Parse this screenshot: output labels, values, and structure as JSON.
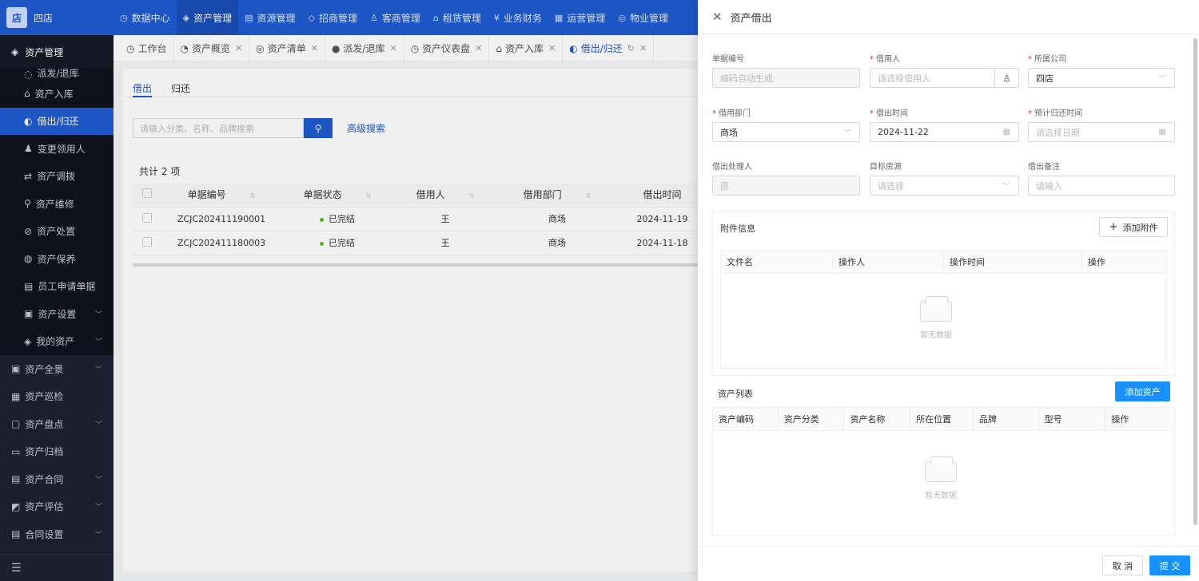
{
  "app": {
    "logo_text": "四店",
    "logo_glyph": "店"
  },
  "topnav": [
    {
      "icon": "◷",
      "label": "数据中心"
    },
    {
      "icon": "◈",
      "label": "资产管理",
      "active": true
    },
    {
      "icon": "▤",
      "label": "资源管理"
    },
    {
      "icon": "◇",
      "label": "招商管理"
    },
    {
      "icon": "♙",
      "label": "客商管理"
    },
    {
      "icon": "⌂",
      "label": "租赁管理"
    },
    {
      "icon": "¥",
      "label": "业务财务"
    },
    {
      "icon": "▦",
      "label": "运营管理"
    },
    {
      "icon": "◎",
      "label": "物业管理"
    }
  ],
  "sidebar": {
    "group": "资产管理",
    "items": [
      {
        "label": "派发/退库",
        "icon": "◌"
      },
      {
        "label": "资产入库",
        "icon": "⌂"
      },
      {
        "label": "借出/归还",
        "icon": "◐",
        "active": true
      },
      {
        "label": "变更领用人",
        "icon": "♟"
      },
      {
        "label": "资产调拨",
        "icon": "⇄"
      },
      {
        "label": "资产维修",
        "icon": "⚲"
      },
      {
        "label": "资产处置",
        "icon": "⊘"
      },
      {
        "label": "资产保养",
        "icon": "◍"
      },
      {
        "label": "员工申请单据",
        "icon": "▤"
      },
      {
        "label": "资产设置",
        "icon": "▣",
        "chev": true
      },
      {
        "label": "我的资产",
        "icon": "◈",
        "chev": true
      }
    ],
    "top_items": [
      {
        "label": "资产全景",
        "icon": "▣",
        "chev": true
      },
      {
        "label": "资产巡检",
        "icon": "▦"
      },
      {
        "label": "资产盘点",
        "icon": "▢",
        "chev": true
      },
      {
        "label": "资产归档",
        "icon": "▭"
      },
      {
        "label": "资产合同",
        "icon": "▤",
        "chev": true
      },
      {
        "label": "资产评估",
        "icon": "◩",
        "chev": true
      },
      {
        "label": "合同设置",
        "icon": "▤",
        "chev": true
      }
    ],
    "collapse_icon": "☰"
  },
  "tabs": [
    {
      "icon": "◷",
      "label": "工作台",
      "closable": false
    },
    {
      "icon": "◔",
      "label": "资产概览",
      "closable": true
    },
    {
      "icon": "◎",
      "label": "资产清单",
      "closable": true
    },
    {
      "icon": "●",
      "label": "派发/退库",
      "closable": true
    },
    {
      "icon": "◷",
      "label": "资产仪表盘",
      "closable": true
    },
    {
      "icon": "⌂",
      "label": "资产入库",
      "closable": true
    },
    {
      "icon": "◐",
      "label": "借出/归还",
      "closable": true,
      "active": true,
      "refresh": "↻"
    }
  ],
  "main": {
    "subtabs": [
      "借出",
      "归还"
    ],
    "search_placeholder": "请输入分类、名称、品牌搜索",
    "search_icon": "⚲",
    "advanced": "高级搜索",
    "total": "共计 2 项",
    "columns": [
      "单据编号",
      "单据状态",
      "借用人",
      "借用部门",
      "借出时间"
    ],
    "rows": [
      {
        "no": "ZCJC202411190001",
        "status": "已完结",
        "borrower": "王",
        "dept": "商场",
        "time": "2024-11-19"
      },
      {
        "no": "ZCJC202411180003",
        "status": "已完结",
        "borrower": "王",
        "dept": "商场",
        "time": "2024-11-18"
      }
    ]
  },
  "drawer": {
    "title": "资产借出",
    "close_icon": "✕",
    "fields": {
      "doc_no": {
        "label": "单据编号",
        "placeholder": "编码自动生成"
      },
      "borrower": {
        "label": "借用人",
        "placeholder": "请选择借用人",
        "icon": "♙"
      },
      "company": {
        "label": "所属公司",
        "value": "四店"
      },
      "dept": {
        "label": "借用部门",
        "value": "商场"
      },
      "lend_time": {
        "label": "借出时间",
        "value": "2024-11-22"
      },
      "return_time": {
        "label": "预计归还时间",
        "placeholder": "请选择日期"
      },
      "handler": {
        "label": "借出处理人",
        "value": "邵"
      },
      "target": {
        "label": "目标房源",
        "placeholder": "请选择"
      },
      "remark": {
        "label": "借出备注",
        "placeholder": "请输入"
      }
    },
    "attach": {
      "title": "附件信息",
      "add_btn": "添加附件",
      "columns": [
        "文件名",
        "操作人",
        "操作时间",
        "操作"
      ],
      "empty": "暂无数据"
    },
    "assets": {
      "title": "资产列表",
      "add_btn": "添加资产",
      "columns": [
        "资产编码",
        "资产分类",
        "资产名称",
        "所在位置",
        "品牌",
        "型号",
        "操作"
      ],
      "empty": "暂无数据"
    },
    "footer": {
      "cancel": "取 消",
      "submit": "提 交"
    }
  }
}
